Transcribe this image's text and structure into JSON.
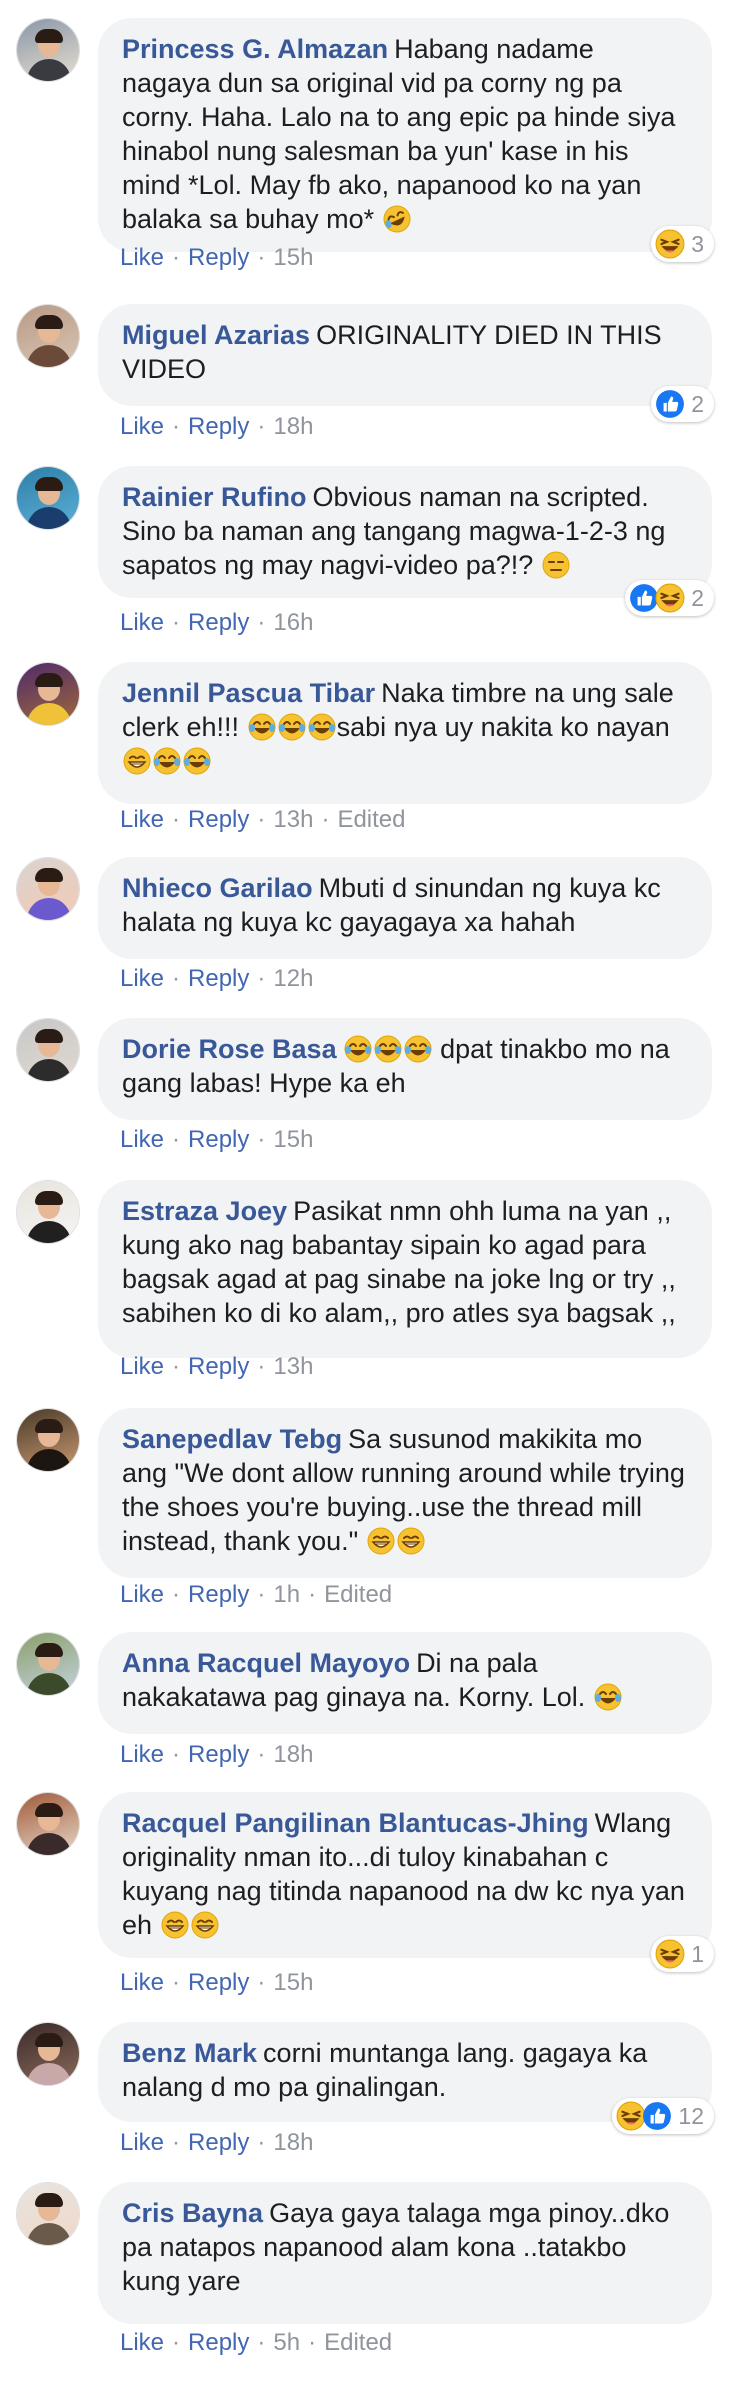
{
  "colors": {
    "link": "#4267b2",
    "author": "#385898",
    "bubble": "#f2f3f5",
    "meta": "#90949c"
  },
  "labels": {
    "like": "Like",
    "reply": "Reply",
    "edited": "Edited"
  },
  "comments": [
    {
      "author": "Princess G. Almazan",
      "text": "Habang nadame nagaya dun sa original vid pa corny ng pa corny. Haha. Lalo na to ang epic pa hinde siya hinabol nung salesman ba yun' kase in his mind *Lol. May fb ako, napanood ko na yan balaka sa buhay mo*",
      "text_emojis": [
        "rofl"
      ],
      "time": "15h",
      "edited": false,
      "reactions": {
        "icons": [
          "haha"
        ],
        "count": "3"
      },
      "avatar": "avatar-couple-photo"
    },
    {
      "author": "Miguel Azarias",
      "text": "ORIGINALITY DIED IN THIS VIDEO",
      "text_emojis": [],
      "time": "18h",
      "edited": false,
      "reactions": {
        "icons": [
          "like"
        ],
        "count": "2"
      },
      "avatar": "avatar-family-photo"
    },
    {
      "author": "Rainier Rufino",
      "text": "Obvious naman na scripted. Sino ba naman ang tangang magwa-1-2-3 ng sapatos ng may nagvi-video pa?!?",
      "text_emojis": [
        "expressionless"
      ],
      "time": "16h",
      "edited": false,
      "reactions": {
        "icons": [
          "like",
          "haha"
        ],
        "count": "2"
      },
      "avatar": "avatar-cartoon"
    },
    {
      "author": "Jennil Pascua Tibar",
      "text": "Naka timbre na ung sale clerk eh!!!",
      "text_emojis": [
        "joy",
        "joy",
        "joy"
      ],
      "text2": "sabi nya uy nakita ko nayan",
      "text2_emojis": [
        "grin",
        "joy",
        "joy"
      ],
      "time": "13h",
      "edited": true,
      "reactions": null,
      "avatar": "avatar-selfie"
    },
    {
      "author": "Nhieco Garilao",
      "text": "Mbuti d sinundan ng kuya kc halata ng kuya kc gayagaya xa hahah",
      "text_emojis": [],
      "time": "12h",
      "edited": false,
      "reactions": null,
      "avatar": "avatar-jersey"
    },
    {
      "author": "Dorie Rose Basa",
      "text_emojis_before": [
        "joy",
        "joy",
        "joy"
      ],
      "text": "dpat tinakbo mo na gang labas! Hype ka eh",
      "text_emojis": [],
      "time": "15h",
      "edited": false,
      "reactions": null,
      "avatar": "avatar-collage"
    },
    {
      "author": "Estraza Joey",
      "text": "Pasikat nmn ohh luma na yan ,, kung ako nag babantay sipain ko agad para bagsak agad at pag sinabe na joke lng or try ,, sabihen ko di ko alam,, pro atles sya bagsak ,,",
      "text_emojis": [],
      "time": "13h",
      "edited": false,
      "reactions": null,
      "avatar": "avatar-man-white"
    },
    {
      "author": "Sanepedlav Tebg",
      "text": "Sa susunod makikita mo ang \"We dont allow running around while trying the shoes you're buying..use the thread mill instead, thank you.\"",
      "text_emojis": [
        "grin",
        "grin"
      ],
      "time": "1h",
      "edited": true,
      "reactions": null,
      "avatar": "avatar-closeup"
    },
    {
      "author": "Anna Racquel Mayoyo",
      "text": "Di na pala nakakatawa pag ginaya na. Korny. Lol.",
      "text_emojis": [
        "joy"
      ],
      "time": "18h",
      "edited": false,
      "reactions": null,
      "avatar": "avatar-landscape"
    },
    {
      "author": "Racquel Pangilinan Blantucas-Jhing",
      "text": "Wlang originality nman ito...di tuloy kinabahan c kuyang nag titinda napanood na dw kc nya yan eh",
      "text_emojis": [
        "grin",
        "grin"
      ],
      "time": "15h",
      "edited": false,
      "reactions": {
        "icons": [
          "haha"
        ],
        "count": "1"
      },
      "avatar": "avatar-group"
    },
    {
      "author": "Benz Mark",
      "text": "corni muntanga lang. gagaya ka nalang d mo pa ginalingan.",
      "text_emojis": [],
      "time": "18h",
      "edited": false,
      "reactions": {
        "icons": [
          "haha",
          "like"
        ],
        "count": "12"
      },
      "avatar": "avatar-two-faces"
    },
    {
      "author": "Cris Bayna",
      "text": "Gaya gaya talaga mga pinoy..dko pa natapos napanood alam kona ..tatakbo kung yare",
      "text_emojis": [],
      "time": "5h",
      "edited": true,
      "reactions": null,
      "avatar": "avatar-baby"
    }
  ]
}
